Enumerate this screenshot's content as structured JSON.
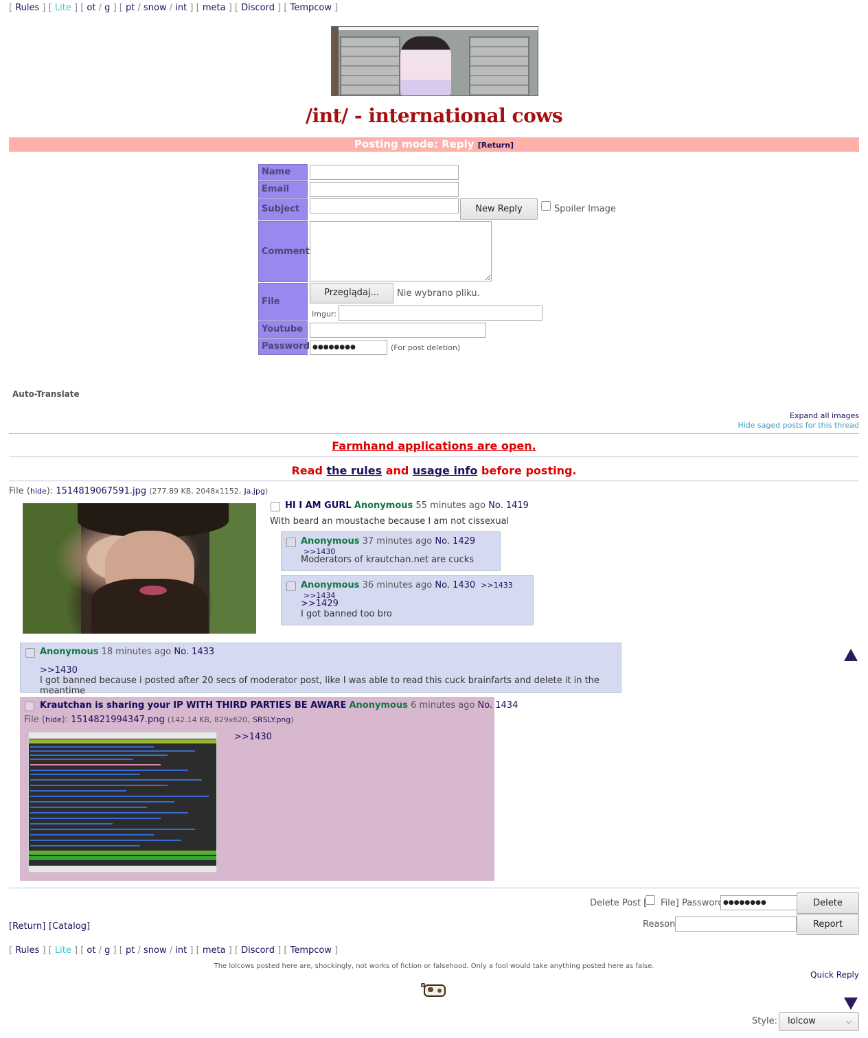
{
  "boardlist": {
    "lb": "[",
    "rb": "]",
    "sl": "/",
    "rules": "Rules",
    "lite": "Lite",
    "ot": "ot",
    "g": "g",
    "pt": "pt",
    "snow": "snow",
    "int": "int",
    "meta": "meta",
    "discord": "Discord",
    "tempcow": "Tempcow"
  },
  "board_title": "/int/ - international cows",
  "post_mode": {
    "text": "Posting mode: Reply",
    "return": "[Return]"
  },
  "form": {
    "name_label": "Name",
    "email_label": "Email",
    "subject_label": "Subject",
    "comment_label": "Comment",
    "file_label": "File",
    "youtube_label": "Youtube",
    "password_label": "Password",
    "new_reply": "New Reply",
    "spoiler": "Spoiler Image",
    "browse": "Przeglądaj...",
    "no_file": "Nie wybrano pliku.",
    "imgur": "Imgur:",
    "password_value": "●●●●●●●●",
    "password_note": "(For post deletion)"
  },
  "auto_translate": "Auto-Translate",
  "expand_all": "Expand all images",
  "hide_saged": "Hide saged posts for this thread",
  "announce": {
    "farmhand": "Farmhand applications are open.",
    "read": "Read",
    "the_rules": "the rules",
    "and": "and",
    "usage": "usage info",
    "before": "before posting."
  },
  "op": {
    "file_prefix": "File (",
    "hide": "hide",
    "file_mid": "):",
    "filename": "1514819067591.jpg",
    "fileinfo_open": "(277.89 KB, 2048x1152,",
    "orig": "Ja.jpg",
    "fileinfo_close": ")",
    "subject": "HI I AM GURL",
    "name": "Anonymous",
    "time": "55 minutes ago",
    "no": "No. 1419",
    "body": "With beard an moustache because I am not cissexual"
  },
  "replies": [
    {
      "name": "Anonymous",
      "time": "37 minutes ago",
      "no": "No. 1429",
      "backlinks": [
        ">>1430"
      ],
      "body": "Moderators of krautchan.net are cucks"
    },
    {
      "name": "Anonymous",
      "time": "36 minutes ago",
      "no": "No. 1430",
      "backlinks": [
        ">>1433",
        ">>1434"
      ],
      "quote": ">>1429",
      "body": "I got banned too bro"
    },
    {
      "name": "Anonymous",
      "time": "18 minutes ago",
      "no": "No. 1433",
      "quote": ">>1430",
      "body": "I got banned because i posted after 20 secs of moderator post, like I was able to read this cuck brainfarts and delete it in the meantime"
    },
    {
      "subject": "Krautchan is sharing your IP WITH THIRD PARTIES BE AWARE",
      "name": "Anonymous",
      "time": "6 minutes ago",
      "no": "No. 1434",
      "file_prefix": "File (",
      "hide": "hide",
      "file_mid": "):",
      "filename": "1514821994347.png",
      "fileinfo_open": "(142.14 KB, 829x620,",
      "orig": "SRSLY.png",
      "fileinfo_close": ")",
      "quote": ">>1430"
    }
  ],
  "footer": {
    "delete_post": "Delete Post [",
    "file_pw": "File] Password",
    "password_value": "●●●●●●●●",
    "delete": "Delete",
    "reason": "Reason",
    "report": "Report",
    "return": "[Return]",
    "catalog": "[Catalog]",
    "disclaimer": "The lolcows posted here are, shockingly, not works of fiction or falsehood. Only a fool would take anything posted here as false.",
    "quick_reply": "Quick Reply",
    "style_label": "Style:",
    "style_value": "lolcow"
  },
  "colors": {
    "accent": "#a50f0f",
    "post_bg": "#d6daf0",
    "form_label": "#9988ee",
    "name": "#117743",
    "highlight_post": "#d7b8cf"
  }
}
